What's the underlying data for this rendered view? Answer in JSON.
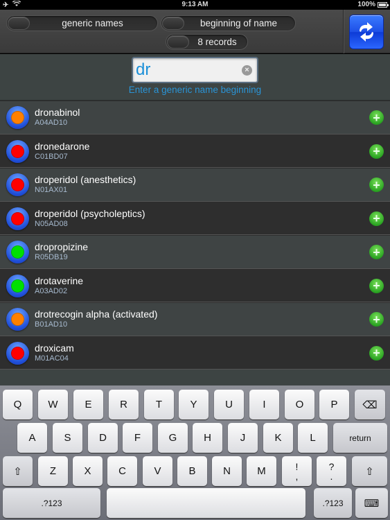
{
  "status_bar": {
    "time": "9:13 AM",
    "battery": "100%",
    "icons": [
      "airplane-icon",
      "wifi-icon",
      "battery-icon"
    ]
  },
  "toolbar": {
    "toggles": [
      {
        "label": "generic names",
        "state": "off"
      },
      {
        "label": "beginning of name",
        "state": "off"
      },
      {
        "label": "8 records",
        "state": "off"
      }
    ],
    "refresh_icon": "refresh-icon"
  },
  "search": {
    "value": "dr",
    "hint": "Enter a generic name beginning",
    "clear_icon": "clear-icon"
  },
  "colors": {
    "orange": "#ff8000",
    "red": "#ff0000",
    "green": "#00e000",
    "hint": "#2a94d6",
    "input_text": "#1a8fd8"
  },
  "list": {
    "items": [
      {
        "name": "dronabinol",
        "code": "A04AD10",
        "status": "orange"
      },
      {
        "name": "dronedarone",
        "code": "C01BD07",
        "status": "red"
      },
      {
        "name": "droperidol (anesthetics)",
        "code": "N01AX01",
        "status": "red"
      },
      {
        "name": "droperidol (psycholeptics)",
        "code": "N05AD08",
        "status": "red"
      },
      {
        "name": "dropropizine",
        "code": "R05DB19",
        "status": "green"
      },
      {
        "name": "drotaverine",
        "code": "A03AD02",
        "status": "green"
      },
      {
        "name": "drotrecogin alpha (activated)",
        "code": "B01AD10",
        "status": "orange"
      },
      {
        "name": "droxicam",
        "code": "M01AC04",
        "status": "red"
      }
    ],
    "add_icon": "plus-icon"
  },
  "keyboard": {
    "row1": [
      "Q",
      "W",
      "E",
      "R",
      "T",
      "Y",
      "U",
      "I",
      "O",
      "P",
      "⌫"
    ],
    "row2": [
      "A",
      "S",
      "D",
      "F",
      "G",
      "H",
      "J",
      "K",
      "L",
      "return"
    ],
    "row3": [
      "⇧",
      "Z",
      "X",
      "C",
      "V",
      "B",
      "N",
      "M",
      "!\n,",
      "?\n.",
      "⇧"
    ],
    "row4": [
      ".?123",
      "",
      ".?123",
      "⌨"
    ]
  }
}
